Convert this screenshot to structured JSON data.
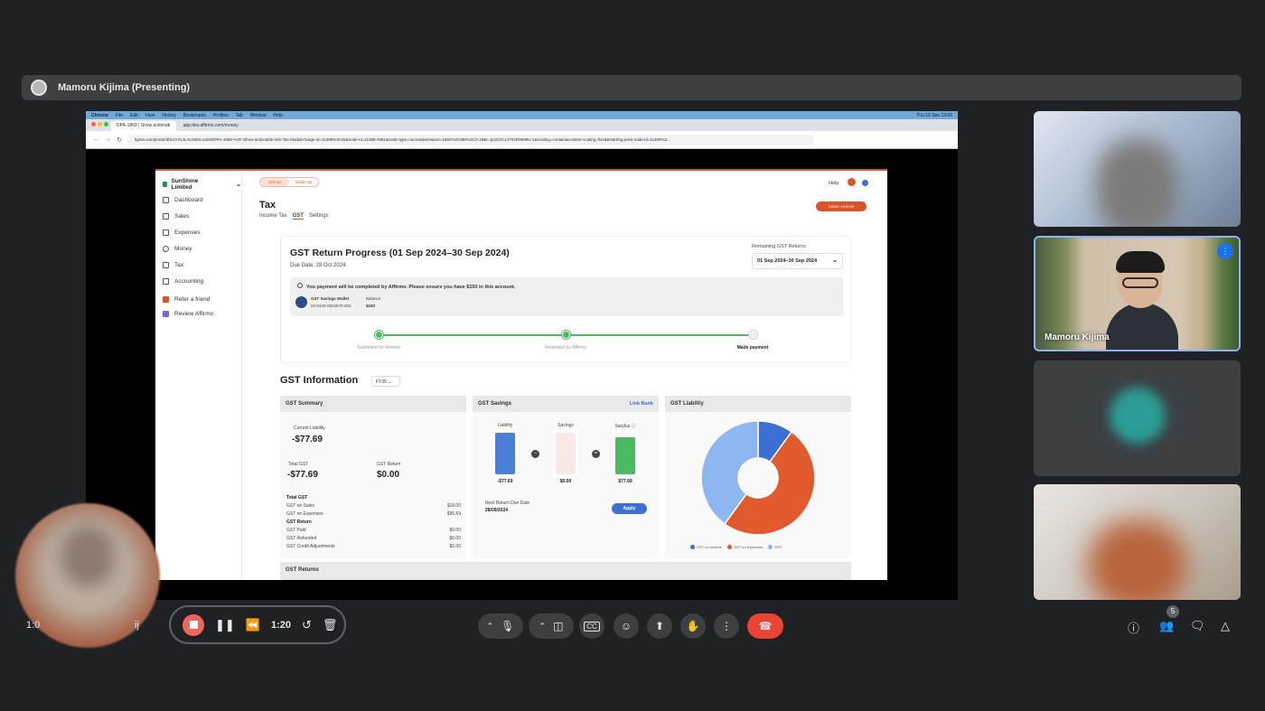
{
  "presenter": {
    "label": "Mamoru Kijima (Presenting)"
  },
  "browser": {
    "menubar": [
      "Chrome",
      "File",
      "Edit",
      "View",
      "History",
      "Bookmarks",
      "Profiles",
      "Tab",
      "Window",
      "Help"
    ],
    "clock": "Thu 19 Sep 13:06",
    "tabs": [
      "DPA-1869 | Show actionab",
      "app.dev.affirmo.com/money"
    ],
    "url": "figma.com/proto/nf0x1YXvJLAU1BHLu4rtel/DPA-1869-%2F-Show-actionable-info-Tax-Module?page-id=11398%3A32&node-id=11398-4981&node-type=canvas&viewport=1892%2C984%2C0.18&t=Jp1D2C14702RWM9U-1&scaling=contain&content-scaling=fixed&starting-point-node-id=11469%3..."
  },
  "app": {
    "company": "SunShine Limited",
    "sidebar": [
      {
        "label": "Dashboard"
      },
      {
        "label": "Sales"
      },
      {
        "label": "Expenses"
      },
      {
        "label": "Money"
      },
      {
        "label": "Tax"
      },
      {
        "label": "Accounting"
      },
      {
        "label": "Refer a friend"
      },
      {
        "label": "Review Affirmo"
      }
    ],
    "pill": {
      "setup": "Set Up",
      "scaleup": "Scale Up"
    },
    "help": "Help",
    "cta": "DEMO VIDEOS",
    "title": "Tax",
    "tabs": {
      "income": "Income Tax",
      "gst": "GST",
      "settings": "Settings"
    },
    "progress": {
      "title": "GST Return Progress (01 Sep 2024–30 Sep 2024)",
      "due": "Due Date: 28 Oct 2024",
      "remaining_label": "Remaining GST Returns",
      "remaining_value": "01 Sep 2024–30 Sep 2024",
      "note": "You payment will be completed by Affirmo. Please ensure you have $150 in this account.",
      "wallet_name": "GST Savings Wallet",
      "wallet_acct": "02-0108-0524578-002",
      "balance_label": "Balance",
      "balance_value": "$150",
      "steps": [
        "Submitted for Review",
        "Reviewed by Affirmo",
        "Made payment"
      ]
    },
    "gst_info": {
      "title": "GST Information",
      "fy": "FY25",
      "summary": {
        "head": "GST Summary",
        "current_label": "Current Liability",
        "current_value": "-$77.69",
        "total_label": "Total GST",
        "total_value": "-$77.69",
        "return_label": "GST Return",
        "return_value": "$0.00",
        "rows": [
          {
            "label": "Total GST",
            "value": "",
            "bold": true
          },
          {
            "label": "GST on Sales",
            "value": "$18.00"
          },
          {
            "label": "GST on Expenses",
            "value": "$95.69"
          },
          {
            "label": "GST Return",
            "value": "",
            "bold": true
          },
          {
            "label": "GST Paid",
            "value": "$0.00"
          },
          {
            "label": "GST Refunded",
            "value": "$0.00"
          },
          {
            "label": "GST Credit Adjustments",
            "value": "$0.00"
          }
        ]
      },
      "savings": {
        "head": "GST Savings",
        "link": "Link Bank",
        "liability_label": "Liability",
        "liability_value": "-$77.69",
        "savings_label": "Savings",
        "savings_value": "$0.00",
        "surplus_label": "Surplus",
        "surplus_value": "$77.69",
        "next_due_label": "Next Return Due Date",
        "next_due_value": "28/09/2024",
        "apply": "Apply"
      },
      "liability": {
        "head": "GST Liability",
        "legend": [
          "GST on Income",
          "GST on Expenses",
          "GST"
        ],
        "colors": [
          "#3b6fd1",
          "#e05a2b",
          "#8eb6f0"
        ]
      },
      "returns_head": "GST Returns"
    }
  },
  "chart_data": {
    "type": "pie",
    "categories": [
      "GST on Income",
      "GST on Expenses",
      "GST"
    ],
    "values": [
      10,
      50,
      40
    ],
    "title": "GST Liability",
    "style": "donut"
  },
  "participants": [
    {
      "name": ""
    },
    {
      "name": "Mamoru Kijima"
    },
    {
      "name": ""
    },
    {
      "name": ""
    }
  ],
  "recording": {
    "time": "1:20",
    "left_text": "1:0",
    "right_text": "ij"
  },
  "people_count": "5"
}
